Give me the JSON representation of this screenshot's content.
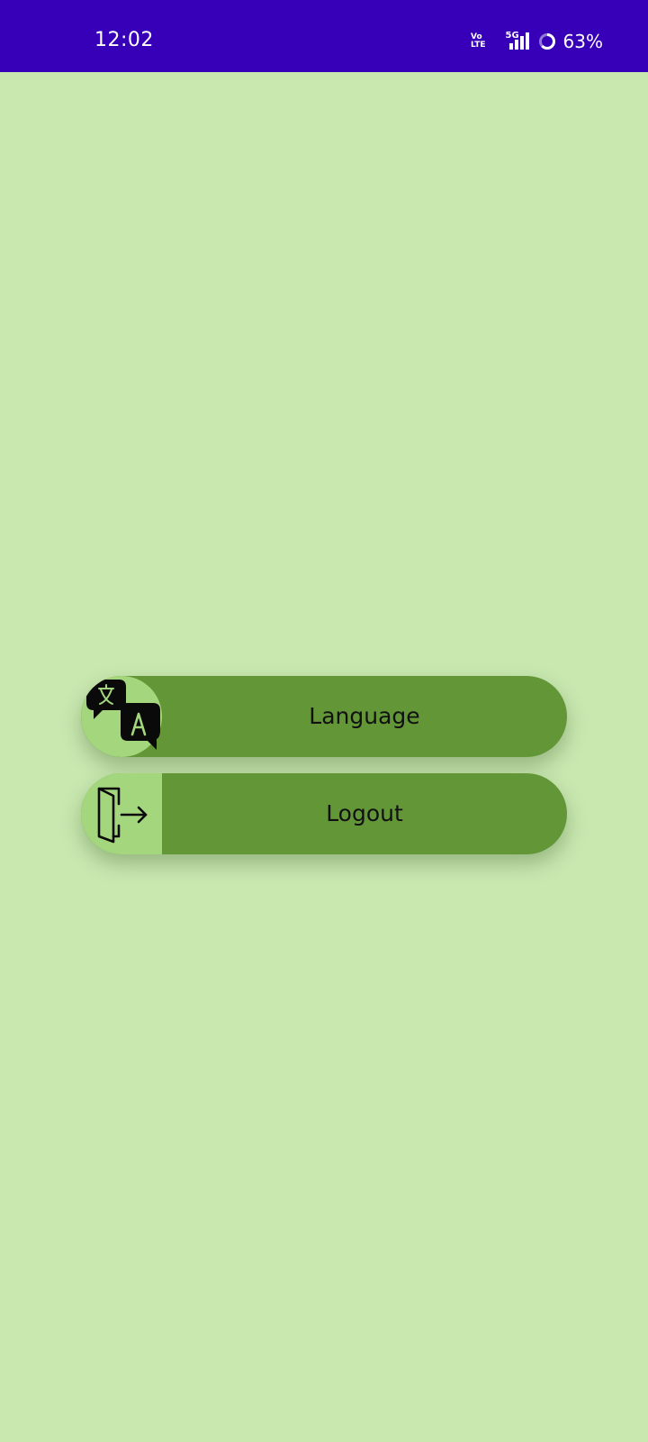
{
  "status_bar": {
    "time": "12:02",
    "volte_top": "Vo",
    "volte_bottom": "LTE",
    "network": "5G",
    "battery": "63%"
  },
  "menu": {
    "language_label": "Language",
    "logout_label": "Logout"
  },
  "icons": {
    "language": "translate-icon",
    "logout": "exit-door-icon"
  },
  "colors": {
    "status_bar": "#3700b8",
    "background": "#c8e8b0",
    "button": "#629637",
    "icon_zone": "#a4d67e"
  }
}
